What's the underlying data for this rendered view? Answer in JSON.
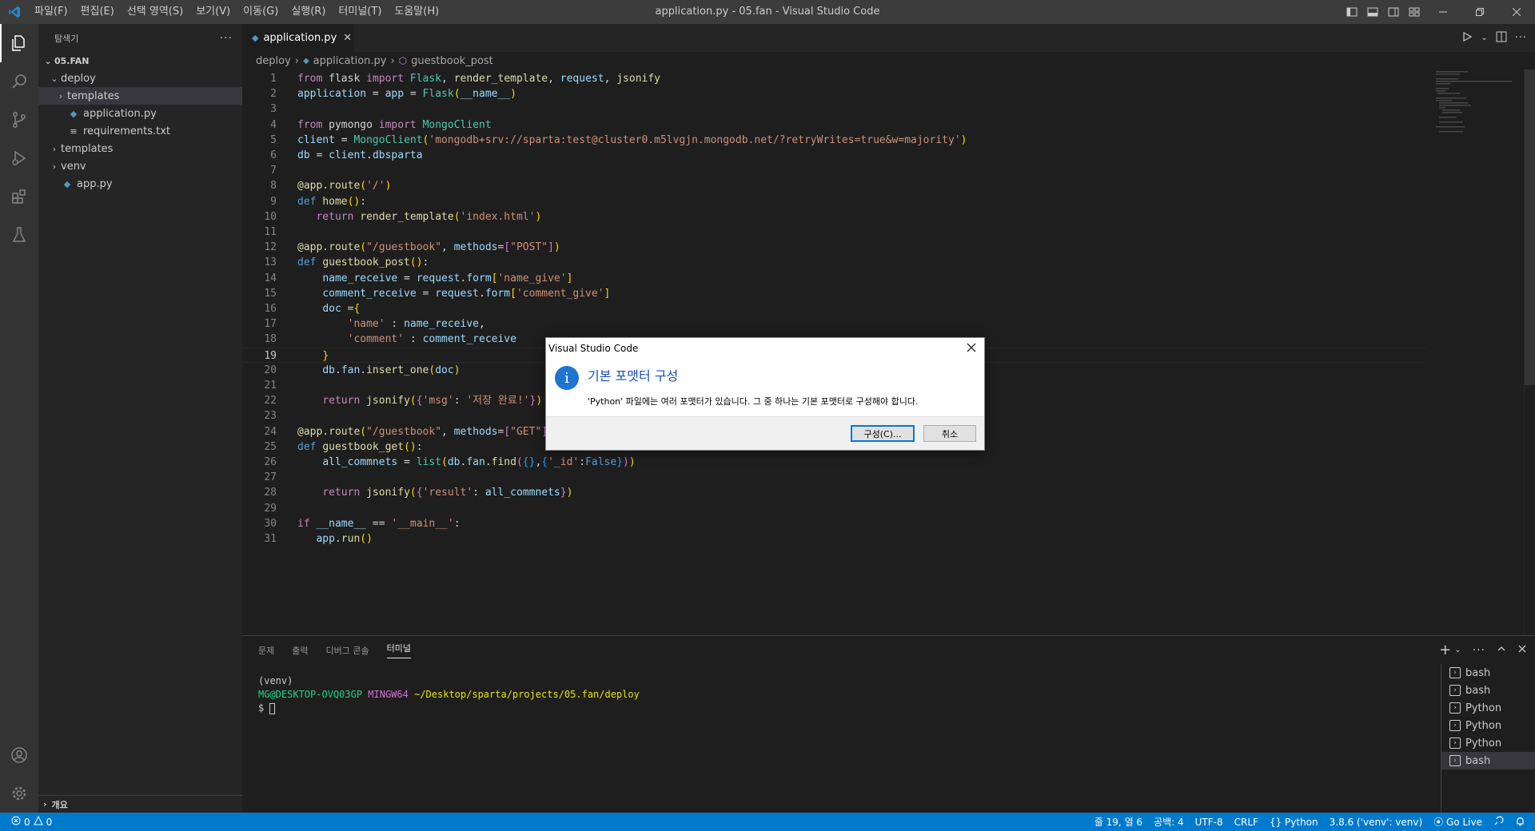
{
  "window": {
    "title": "application.py - 05.fan - Visual Studio Code",
    "menu": [
      "파일(F)",
      "편집(E)",
      "선택 영역(S)",
      "보기(V)",
      "이동(G)",
      "실행(R)",
      "터미널(T)",
      "도움말(H)"
    ]
  },
  "sidebar": {
    "header": "탐색기",
    "more": "···",
    "tree": [
      {
        "label": "05.FAN",
        "depth": 0,
        "type": "root"
      },
      {
        "label": "deploy",
        "depth": 1,
        "type": "folder-open"
      },
      {
        "label": "templates",
        "depth": 2,
        "type": "folder-closed"
      },
      {
        "label": "application.py",
        "depth": 2,
        "type": "py"
      },
      {
        "label": "requirements.txt",
        "depth": 2,
        "type": "txt"
      },
      {
        "label": "templates",
        "depth": 1,
        "type": "folder-closed"
      },
      {
        "label": "venv",
        "depth": 1,
        "type": "folder-closed"
      },
      {
        "label": "app.py",
        "depth": 1,
        "type": "py"
      }
    ],
    "outline": "개요"
  },
  "editor": {
    "tab_label": "application.py",
    "breadcrumb": [
      "deploy",
      "application.py",
      "guestbook_post"
    ],
    "current_line": 19
  },
  "code_lines": [
    [
      [
        "kw",
        "from "
      ],
      [
        "plain",
        "flask "
      ],
      [
        "kw",
        "import "
      ],
      [
        "cls",
        "Flask"
      ],
      [
        "plain",
        ", "
      ],
      [
        "fn",
        "render_template"
      ],
      [
        "plain",
        ", "
      ],
      [
        "var",
        "request"
      ],
      [
        "plain",
        ", "
      ],
      [
        "fn",
        "jsonify"
      ]
    ],
    [
      [
        "var",
        "application"
      ],
      [
        "plain",
        " = "
      ],
      [
        "var",
        "app"
      ],
      [
        "plain",
        " = "
      ],
      [
        "cls",
        "Flask"
      ],
      [
        "br1",
        "("
      ],
      [
        "var",
        "__name__"
      ],
      [
        "br1",
        ")"
      ]
    ],
    [],
    [
      [
        "kw",
        "from "
      ],
      [
        "plain",
        "pymongo "
      ],
      [
        "kw",
        "import "
      ],
      [
        "cls",
        "MongoClient"
      ]
    ],
    [
      [
        "var",
        "client"
      ],
      [
        "plain",
        " = "
      ],
      [
        "cls",
        "MongoClient"
      ],
      [
        "br1",
        "("
      ],
      [
        "str",
        "'mongodb+srv://sparta:test@cluster0.m5lvgjn.mongodb.net/?retryWrites=true&w=majority'"
      ],
      [
        "br1",
        ")"
      ]
    ],
    [
      [
        "var",
        "db"
      ],
      [
        "plain",
        " = "
      ],
      [
        "var",
        "client"
      ],
      [
        "plain",
        "."
      ],
      [
        "var",
        "dbsparta"
      ]
    ],
    [],
    [
      [
        "dec",
        "@app.route"
      ],
      [
        "br1",
        "("
      ],
      [
        "str",
        "'/'"
      ],
      [
        "br1",
        ")"
      ]
    ],
    [
      [
        "kw2",
        "def "
      ],
      [
        "fn",
        "home"
      ],
      [
        "br1",
        "()"
      ],
      [
        "plain",
        ":"
      ]
    ],
    [
      [
        "plain",
        "   "
      ],
      [
        "kw",
        "return "
      ],
      [
        "fn",
        "render_template"
      ],
      [
        "br1",
        "("
      ],
      [
        "str",
        "'index.html'"
      ],
      [
        "br1",
        ")"
      ]
    ],
    [],
    [
      [
        "dec",
        "@app.route"
      ],
      [
        "br1",
        "("
      ],
      [
        "str",
        "\"/guestbook\""
      ],
      [
        "plain",
        ", "
      ],
      [
        "var",
        "methods"
      ],
      [
        "plain",
        "="
      ],
      [
        "br2",
        "["
      ],
      [
        "str",
        "\"POST\""
      ],
      [
        "br2",
        "]"
      ],
      [
        "br1",
        ")"
      ]
    ],
    [
      [
        "kw2",
        "def "
      ],
      [
        "fn",
        "guestbook_post"
      ],
      [
        "br1",
        "()"
      ],
      [
        "plain",
        ":"
      ]
    ],
    [
      [
        "plain",
        "    "
      ],
      [
        "var",
        "name_receive"
      ],
      [
        "plain",
        " = "
      ],
      [
        "var",
        "request"
      ],
      [
        "plain",
        "."
      ],
      [
        "var",
        "form"
      ],
      [
        "br1",
        "["
      ],
      [
        "str",
        "'name_give'"
      ],
      [
        "br1",
        "]"
      ]
    ],
    [
      [
        "plain",
        "    "
      ],
      [
        "var",
        "comment_receive"
      ],
      [
        "plain",
        " = "
      ],
      [
        "var",
        "request"
      ],
      [
        "plain",
        "."
      ],
      [
        "var",
        "form"
      ],
      [
        "br1",
        "["
      ],
      [
        "str",
        "'comment_give'"
      ],
      [
        "br1",
        "]"
      ]
    ],
    [
      [
        "plain",
        "    "
      ],
      [
        "var",
        "doc"
      ],
      [
        "plain",
        " ="
      ],
      [
        "br1",
        "{"
      ]
    ],
    [
      [
        "plain",
        "        "
      ],
      [
        "str",
        "'name'"
      ],
      [
        "plain",
        " : "
      ],
      [
        "var",
        "name_receive"
      ],
      [
        "plain",
        ","
      ]
    ],
    [
      [
        "plain",
        "        "
      ],
      [
        "str",
        "'comment'"
      ],
      [
        "plain",
        " : "
      ],
      [
        "var",
        "comment_receive"
      ]
    ],
    [
      [
        "plain",
        "    "
      ],
      [
        "br1",
        "}"
      ]
    ],
    [
      [
        "plain",
        "    "
      ],
      [
        "var",
        "db"
      ],
      [
        "plain",
        "."
      ],
      [
        "var",
        "fan"
      ],
      [
        "plain",
        "."
      ],
      [
        "fn",
        "insert_one"
      ],
      [
        "br1",
        "("
      ],
      [
        "var",
        "doc"
      ],
      [
        "br1",
        ")"
      ]
    ],
    [],
    [
      [
        "plain",
        "    "
      ],
      [
        "kw",
        "return "
      ],
      [
        "fn",
        "jsonify"
      ],
      [
        "br1",
        "("
      ],
      [
        "br2",
        "{"
      ],
      [
        "str",
        "'msg'"
      ],
      [
        "plain",
        ": "
      ],
      [
        "str",
        "'저장 완료!'"
      ],
      [
        "br2",
        "}"
      ],
      [
        "br1",
        ")"
      ]
    ],
    [],
    [
      [
        "dec",
        "@app.route"
      ],
      [
        "br1",
        "("
      ],
      [
        "str",
        "\"/guestbook\""
      ],
      [
        "plain",
        ", "
      ],
      [
        "var",
        "methods"
      ],
      [
        "plain",
        "="
      ],
      [
        "br2",
        "["
      ],
      [
        "str",
        "\"GET\""
      ],
      [
        "br2",
        "]"
      ],
      [
        "br1",
        ")"
      ]
    ],
    [
      [
        "kw2",
        "def "
      ],
      [
        "fn",
        "guestbook_get"
      ],
      [
        "br1",
        "()"
      ],
      [
        "plain",
        ":"
      ]
    ],
    [
      [
        "plain",
        "    "
      ],
      [
        "var",
        "all_commnets"
      ],
      [
        "plain",
        " = "
      ],
      [
        "cls",
        "list"
      ],
      [
        "br1",
        "("
      ],
      [
        "var",
        "db"
      ],
      [
        "plain",
        "."
      ],
      [
        "var",
        "fan"
      ],
      [
        "plain",
        "."
      ],
      [
        "fn",
        "find"
      ],
      [
        "br2",
        "("
      ],
      [
        "br3",
        "{}"
      ],
      [
        "plain",
        ","
      ],
      [
        "br3",
        "{"
      ],
      [
        "str",
        "'_id'"
      ],
      [
        "plain",
        ":"
      ],
      [
        "kw2",
        "False"
      ],
      [
        "br3",
        "}"
      ],
      [
        "br2",
        ")"
      ],
      [
        "br1",
        ")"
      ]
    ],
    [],
    [
      [
        "plain",
        "    "
      ],
      [
        "kw",
        "return "
      ],
      [
        "fn",
        "jsonify"
      ],
      [
        "br1",
        "("
      ],
      [
        "br2",
        "{"
      ],
      [
        "str",
        "'result'"
      ],
      [
        "plain",
        ": "
      ],
      [
        "var",
        "all_commnets"
      ],
      [
        "br2",
        "}"
      ],
      [
        "br1",
        ")"
      ]
    ],
    [],
    [
      [
        "kw",
        "if "
      ],
      [
        "var",
        "__name__"
      ],
      [
        "plain",
        " == "
      ],
      [
        "str",
        "'__main__'"
      ],
      [
        "plain",
        ":"
      ]
    ],
    [
      [
        "plain",
        "   "
      ],
      [
        "var",
        "app"
      ],
      [
        "plain",
        "."
      ],
      [
        "fn",
        "run"
      ],
      [
        "br1",
        "()"
      ]
    ]
  ],
  "panel": {
    "tabs": [
      "문제",
      "출력",
      "디버그 콘솔",
      "터미널"
    ],
    "active_tab": "터미널",
    "terminal": {
      "line1": "(venv)",
      "user": "MG@DESKTOP-OVQ03GP",
      "env": "MINGW64",
      "path": "~/Desktop/sparta/projects/05.fan/deploy",
      "prompt": "$ "
    },
    "terminal_list": [
      "bash",
      "bash",
      "Python",
      "Python",
      "Python",
      "bash"
    ]
  },
  "statusbar": {
    "errors": "0",
    "warnings": "0",
    "position": "줄 19, 열 6",
    "spaces": "공백: 4",
    "encoding": "UTF-8",
    "eol": "CRLF",
    "language": "Python",
    "interpreter": "3.8.6 ('venv': venv)",
    "golive": "Go Live"
  },
  "dialog": {
    "title": "Visual Studio Code",
    "heading": "기본 포맷터 구성",
    "message": "'Python' 파일에는 여러 포맷터가 있습니다. 그 중 하나는 기본 포맷터로 구성해야 합니다.",
    "primary_button": "구성(C)...",
    "cancel_button": "취소"
  },
  "colors": {
    "accent": "#007acc",
    "info_icon": "#1e74d0"
  }
}
